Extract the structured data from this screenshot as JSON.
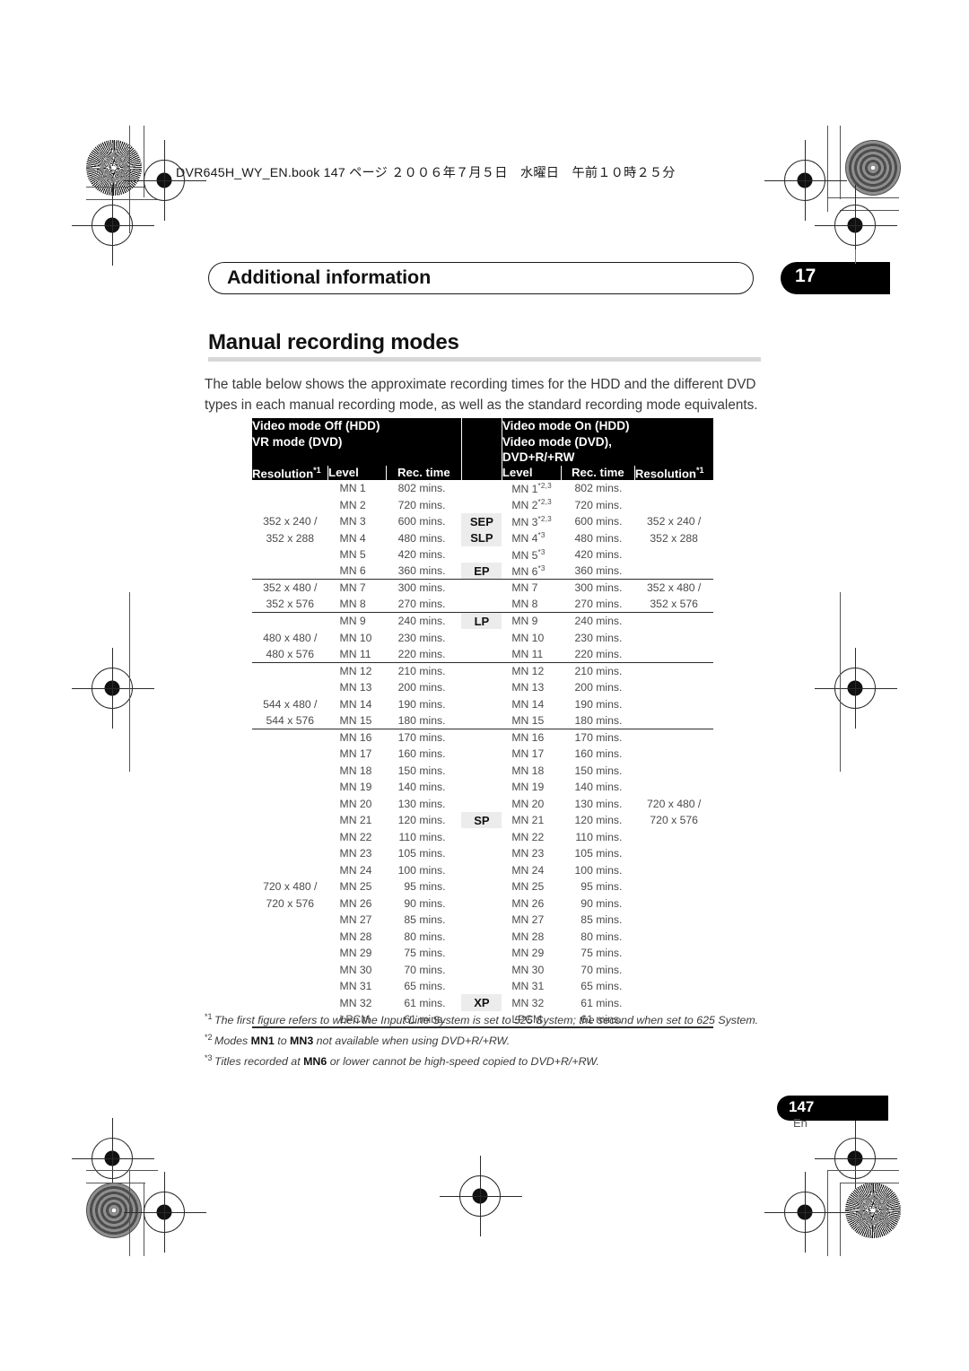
{
  "book_reference": "DVR645H_WY_EN.book  147 ページ  ２００６年７月５日　水曜日　午前１０時２５分",
  "header": {
    "chapter_title": "Additional information",
    "chapter_number": "17"
  },
  "section": {
    "title": "Manual recording modes",
    "intro": "The table below shows the approximate recording times for the HDD and the different DVD types in each manual recording mode, as well as the standard recording mode equivalents."
  },
  "table": {
    "group_left": "Video mode Off (HDD)\nVR mode (DVD)",
    "group_right": "Video mode On (HDD)\nVideo mode (DVD),\nDVD+R/+RW",
    "col_resolution_left": "Resolution",
    "col_level_left": "Level",
    "col_rectime_left": "Rec. time",
    "col_level_right": "Level",
    "col_rectime_right": "Rec. time",
    "col_resolution_right": "Resolution",
    "resolution_sup": "*1",
    "rows": [
      {
        "res_l": "",
        "lvl": "MN 1",
        "time": "802 mins.",
        "std": "",
        "lvl_r": "MN 1",
        "sup_r": "*2,3",
        "time_r": "802 mins.",
        "res_r": ""
      },
      {
        "res_l": "",
        "lvl": "MN 2",
        "time": "720 mins.",
        "std": "",
        "lvl_r": "MN 2",
        "sup_r": "*2,3",
        "time_r": "720 mins.",
        "res_r": ""
      },
      {
        "res_l": "352 x 240 /",
        "lvl": "MN 3",
        "time": "600 mins.",
        "std": "SEP",
        "lvl_r": "MN 3",
        "sup_r": "*2,3",
        "time_r": "600 mins.",
        "res_r": "352 x 240 /"
      },
      {
        "res_l": "352 x 288",
        "lvl": "MN 4",
        "time": "480 mins.",
        "std": "SLP",
        "lvl_r": "MN 4",
        "sup_r": "*3",
        "time_r": "480 mins.",
        "res_r": "352 x 288"
      },
      {
        "res_l": "",
        "lvl": "MN 5",
        "time": "420 mins.",
        "std": "",
        "lvl_r": "MN 5",
        "sup_r": "*3",
        "time_r": "420 mins.",
        "res_r": ""
      },
      {
        "res_l": "",
        "lvl": "MN 6",
        "time": "360 mins.",
        "std": "EP",
        "lvl_r": "MN 6",
        "sup_r": "*3",
        "time_r": "360 mins.",
        "res_r": ""
      },
      {
        "res_l": "352 x 480 /",
        "lvl": "MN 7",
        "time": "300 mins.",
        "std": "",
        "lvl_r": "MN 7",
        "sup_r": "",
        "time_r": "300 mins.",
        "res_r": "352 x 480 /"
      },
      {
        "res_l": "352 x 576",
        "lvl": "MN 8",
        "time": "270 mins.",
        "std": "",
        "lvl_r": "MN 8",
        "sup_r": "",
        "time_r": "270 mins.",
        "res_r": "352 x 576"
      },
      {
        "res_l": "",
        "lvl": "MN 9",
        "time": "240 mins.",
        "std": "LP",
        "lvl_r": "MN 9",
        "sup_r": "",
        "time_r": "240 mins.",
        "res_r": ""
      },
      {
        "res_l": "480 x 480 /",
        "lvl": "MN 10",
        "time": "230 mins.",
        "std": "",
        "lvl_r": "MN 10",
        "sup_r": "",
        "time_r": "230 mins.",
        "res_r": ""
      },
      {
        "res_l": "480 x 576",
        "lvl": "MN 11",
        "time": "220 mins.",
        "std": "",
        "lvl_r": "MN 11",
        "sup_r": "",
        "time_r": "220 mins.",
        "res_r": ""
      },
      {
        "res_l": "",
        "lvl": "MN 12",
        "time": "210 mins.",
        "std": "",
        "lvl_r": "MN 12",
        "sup_r": "",
        "time_r": "210 mins.",
        "res_r": ""
      },
      {
        "res_l": "",
        "lvl": "MN 13",
        "time": "200 mins.",
        "std": "",
        "lvl_r": "MN 13",
        "sup_r": "",
        "time_r": "200 mins.",
        "res_r": ""
      },
      {
        "res_l": "544 x 480 /",
        "lvl": "MN 14",
        "time": "190 mins.",
        "std": "",
        "lvl_r": "MN 14",
        "sup_r": "",
        "time_r": "190 mins.",
        "res_r": ""
      },
      {
        "res_l": "544 x 576",
        "lvl": "MN 15",
        "time": "180 mins.",
        "std": "",
        "lvl_r": "MN 15",
        "sup_r": "",
        "time_r": "180 mins.",
        "res_r": ""
      },
      {
        "res_l": "",
        "lvl": "MN 16",
        "time": "170 mins.",
        "std": "",
        "lvl_r": "MN 16",
        "sup_r": "",
        "time_r": "170 mins.",
        "res_r": ""
      },
      {
        "res_l": "",
        "lvl": "MN 17",
        "time": "160 mins.",
        "std": "",
        "lvl_r": "MN 17",
        "sup_r": "",
        "time_r": "160 mins.",
        "res_r": ""
      },
      {
        "res_l": "",
        "lvl": "MN 18",
        "time": "150 mins.",
        "std": "",
        "lvl_r": "MN 18",
        "sup_r": "",
        "time_r": "150 mins.",
        "res_r": ""
      },
      {
        "res_l": "",
        "lvl": "MN 19",
        "time": "140 mins.",
        "std": "",
        "lvl_r": "MN 19",
        "sup_r": "",
        "time_r": "140 mins.",
        "res_r": ""
      },
      {
        "res_l": "",
        "lvl": "MN 20",
        "time": "130 mins.",
        "std": "",
        "lvl_r": "MN 20",
        "sup_r": "",
        "time_r": "130 mins.",
        "res_r": "720 x 480 /"
      },
      {
        "res_l": "",
        "lvl": "MN 21",
        "time": "120 mins.",
        "std": "SP",
        "lvl_r": "MN 21",
        "sup_r": "",
        "time_r": "120 mins.",
        "res_r": "720 x 576"
      },
      {
        "res_l": "",
        "lvl": "MN 22",
        "time": "110 mins.",
        "std": "",
        "lvl_r": "MN 22",
        "sup_r": "",
        "time_r": "110 mins.",
        "res_r": ""
      },
      {
        "res_l": "",
        "lvl": "MN 23",
        "time": "105 mins.",
        "std": "",
        "lvl_r": "MN 23",
        "sup_r": "",
        "time_r": "105 mins.",
        "res_r": ""
      },
      {
        "res_l": "",
        "lvl": "MN 24",
        "time": "100 mins.",
        "std": "",
        "lvl_r": "MN 24",
        "sup_r": "",
        "time_r": "100 mins.",
        "res_r": ""
      },
      {
        "res_l": "720 x 480 /",
        "lvl": "MN 25",
        "time": "95 mins.",
        "std": "",
        "lvl_r": "MN 25",
        "sup_r": "",
        "time_r": "95 mins.",
        "res_r": ""
      },
      {
        "res_l": "720 x 576",
        "lvl": "MN 26",
        "time": "90 mins.",
        "std": "",
        "lvl_r": "MN 26",
        "sup_r": "",
        "time_r": "90 mins.",
        "res_r": ""
      },
      {
        "res_l": "",
        "lvl": "MN 27",
        "time": "85 mins.",
        "std": "",
        "lvl_r": "MN 27",
        "sup_r": "",
        "time_r": "85 mins.",
        "res_r": ""
      },
      {
        "res_l": "",
        "lvl": "MN 28",
        "time": "80 mins.",
        "std": "",
        "lvl_r": "MN 28",
        "sup_r": "",
        "time_r": "80 mins.",
        "res_r": ""
      },
      {
        "res_l": "",
        "lvl": "MN 29",
        "time": "75 mins.",
        "std": "",
        "lvl_r": "MN 29",
        "sup_r": "",
        "time_r": "75 mins.",
        "res_r": ""
      },
      {
        "res_l": "",
        "lvl": "MN 30",
        "time": "70 mins.",
        "std": "",
        "lvl_r": "MN 30",
        "sup_r": "",
        "time_r": "70 mins.",
        "res_r": ""
      },
      {
        "res_l": "",
        "lvl": "MN 31",
        "time": "65 mins.",
        "std": "",
        "lvl_r": "MN 31",
        "sup_r": "",
        "time_r": "65 mins.",
        "res_r": ""
      },
      {
        "res_l": "",
        "lvl": "MN 32",
        "time": "61 mins.",
        "std": "XP",
        "lvl_r": "MN 32",
        "sup_r": "",
        "time_r": "61 mins.",
        "res_r": ""
      },
      {
        "res_l": "",
        "lvl": "LPCM",
        "time": "61 mins.",
        "std": "",
        "lvl_r": "LPCM",
        "sup_r": "",
        "time_r": "61 mins.",
        "res_r": ""
      }
    ]
  },
  "footnotes": [
    {
      "mark": "*1",
      "text": "The first figure refers to when the Input Line System is set to 525 System; the second when set to 625 System."
    },
    {
      "mark": "*2",
      "text": "Modes MN1 to MN3 not available when using DVD+R/+RW."
    },
    {
      "mark": "*3",
      "text": "Titles recorded at MN6 or lower cannot be high-speed copied to DVD+R/+RW."
    }
  ],
  "page": {
    "number": "147",
    "language": "En"
  }
}
